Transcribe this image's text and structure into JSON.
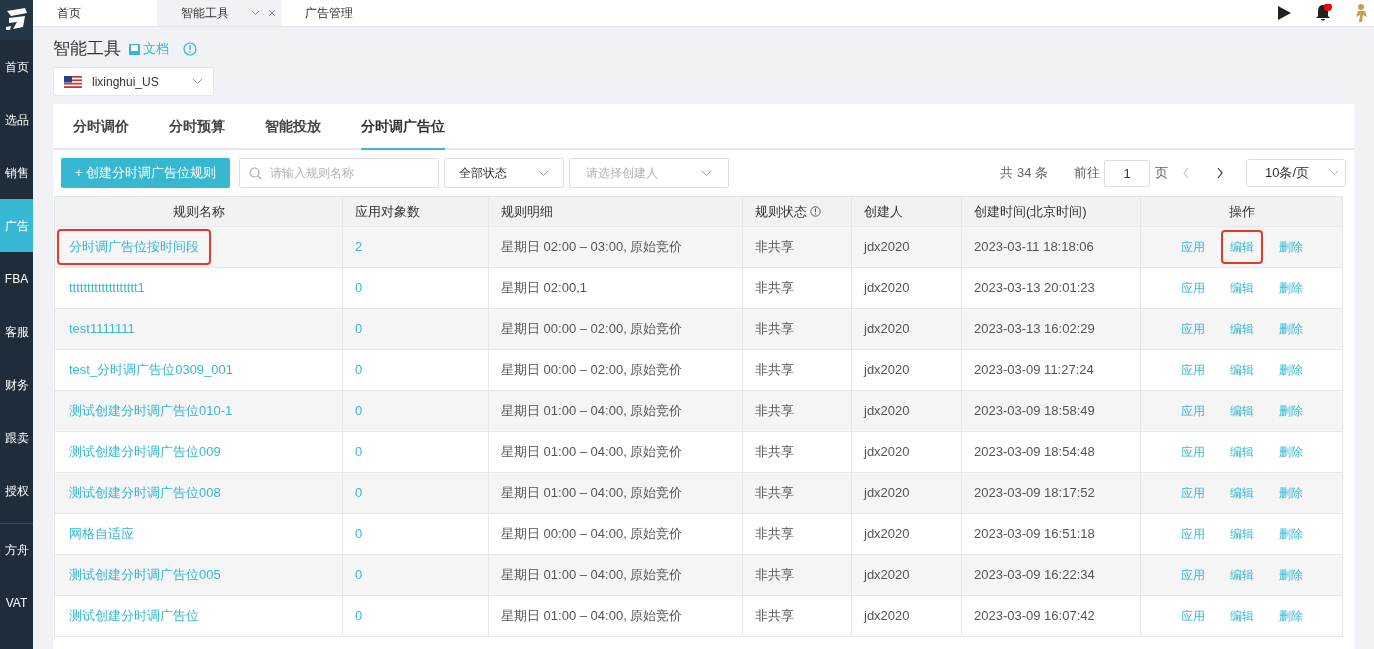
{
  "sidebar": {
    "items": [
      {
        "label": "首页",
        "selected": false
      },
      {
        "label": "选品",
        "selected": false
      },
      {
        "label": "销售",
        "selected": false
      },
      {
        "label": "广告",
        "selected": true
      },
      {
        "label": "FBA",
        "selected": false
      },
      {
        "label": "客服",
        "selected": false
      },
      {
        "label": "财务",
        "selected": false
      },
      {
        "label": "跟卖",
        "selected": false
      },
      {
        "label": "授权",
        "selected": false
      },
      {
        "label": "方舟",
        "selected": false
      },
      {
        "label": "VAT",
        "selected": false
      }
    ]
  },
  "top_tabs": [
    {
      "label": "首页",
      "selected": false
    },
    {
      "label": "智能工具",
      "selected": true
    },
    {
      "label": "广告管理",
      "selected": false
    }
  ],
  "page": {
    "title": "智能工具",
    "doc_link": "文档",
    "account": "lixinghui_US"
  },
  "tabs": [
    {
      "label": "分时调价",
      "selected": false
    },
    {
      "label": "分时预算",
      "selected": false
    },
    {
      "label": "智能投放",
      "selected": false
    },
    {
      "label": "分时调广告位",
      "selected": true
    }
  ],
  "toolbar": {
    "create_button": "+ 创建分时调广告位规则",
    "search": {
      "placeholder": "请输入规则名称"
    },
    "status_select": "全部状态",
    "creator_select": {
      "placeholder": "请选择创建人"
    }
  },
  "pagination": {
    "total": "共 34 条",
    "goto_label": "前往",
    "page": "1",
    "page_unit": "页",
    "page_size": "10条/页"
  },
  "table": {
    "columns": [
      "规则名称",
      "应用对象数",
      "规则明细",
      "规则状态",
      "创建人",
      "创建时间(北京时间)",
      "操作"
    ],
    "rows": [
      {
        "name": "分时调广告位按时间段",
        "count": "2",
        "detail": "星期日 02:00 – 03:00, 原始竞价",
        "status": "非共享",
        "creator": "jdx2020",
        "created": "2023-03-11 18:18:06",
        "name_highlighted": true,
        "actions": [
          {
            "label": "应用",
            "highlighted": false
          },
          {
            "label": "编辑",
            "highlighted": true
          },
          {
            "label": "删除",
            "highlighted": false
          }
        ]
      },
      {
        "name": "ttttttttttttttttttt1",
        "count": "0",
        "detail": "星期日 02:00,1",
        "status": "非共享",
        "creator": "jdx2020",
        "created": "2023-03-13 20:01:23",
        "name_highlighted": false,
        "actions": [
          {
            "label": "应用",
            "highlighted": false
          },
          {
            "label": "编辑",
            "highlighted": false
          },
          {
            "label": "删除",
            "highlighted": false
          }
        ]
      },
      {
        "name": "test1111111",
        "count": "0",
        "detail": "星期日 00:00 – 02:00, 原始竞价",
        "status": "非共享",
        "creator": "jdx2020",
        "created": "2023-03-13 16:02:29",
        "name_highlighted": false,
        "actions": [
          {
            "label": "应用",
            "highlighted": false
          },
          {
            "label": "编辑",
            "highlighted": false
          },
          {
            "label": "删除",
            "highlighted": false
          }
        ]
      },
      {
        "name": "test_分时调广告位0309_001",
        "count": "0",
        "detail": "星期日 00:00 – 02:00, 原始竞价",
        "status": "非共享",
        "creator": "jdx2020",
        "created": "2023-03-09 11:27:24",
        "name_highlighted": false,
        "actions": [
          {
            "label": "应用",
            "highlighted": false
          },
          {
            "label": "编辑",
            "highlighted": false
          },
          {
            "label": "删除",
            "highlighted": false
          }
        ]
      },
      {
        "name": "测试创建分时调广告位010-1",
        "count": "0",
        "detail": "星期日 01:00 – 04:00, 原始竞价",
        "status": "非共享",
        "creator": "jdx2020",
        "created": "2023-03-09 18:58:49",
        "name_highlighted": false,
        "actions": [
          {
            "label": "应用",
            "highlighted": false
          },
          {
            "label": "编辑",
            "highlighted": false
          },
          {
            "label": "删除",
            "highlighted": false
          }
        ]
      },
      {
        "name": "测试创建分时调广告位009",
        "count": "0",
        "detail": "星期日 01:00 – 04:00, 原始竞价",
        "status": "非共享",
        "creator": "jdx2020",
        "created": "2023-03-09 18:54:48",
        "name_highlighted": false,
        "actions": [
          {
            "label": "应用",
            "highlighted": false
          },
          {
            "label": "编辑",
            "highlighted": false
          },
          {
            "label": "删除",
            "highlighted": false
          }
        ]
      },
      {
        "name": "测试创建分时调广告位008",
        "count": "0",
        "detail": "星期日 01:00 – 04:00, 原始竞价",
        "status": "非共享",
        "creator": "jdx2020",
        "created": "2023-03-09 18:17:52",
        "name_highlighted": false,
        "actions": [
          {
            "label": "应用",
            "highlighted": false
          },
          {
            "label": "编辑",
            "highlighted": false
          },
          {
            "label": "删除",
            "highlighted": false
          }
        ]
      },
      {
        "name": "网格自适应",
        "count": "0",
        "detail": "星期日 00:00 – 04:00, 原始竞价",
        "status": "非共享",
        "creator": "jdx2020",
        "created": "2023-03-09 16:51:18",
        "name_highlighted": false,
        "actions": [
          {
            "label": "应用",
            "highlighted": false
          },
          {
            "label": "编辑",
            "highlighted": false
          },
          {
            "label": "删除",
            "highlighted": false
          }
        ]
      },
      {
        "name": "测试创建分时调广告位005",
        "count": "0",
        "detail": "星期日 01:00 – 04:00, 原始竞价",
        "status": "非共享",
        "creator": "jdx2020",
        "created": "2023-03-09 16:22:34",
        "name_highlighted": false,
        "actions": [
          {
            "label": "应用",
            "highlighted": false
          },
          {
            "label": "编辑",
            "highlighted": false
          },
          {
            "label": "删除",
            "highlighted": false
          }
        ]
      },
      {
        "name": "测试创建分时调广告位",
        "count": "0",
        "detail": "星期日 01:00 – 04:00, 原始竞价",
        "status": "非共享",
        "creator": "jdx2020",
        "created": "2023-03-09 16:07:42",
        "name_highlighted": false,
        "actions": [
          {
            "label": "应用",
            "highlighted": false
          },
          {
            "label": "编辑",
            "highlighted": false
          },
          {
            "label": "删除",
            "highlighted": false
          }
        ]
      }
    ]
  }
}
